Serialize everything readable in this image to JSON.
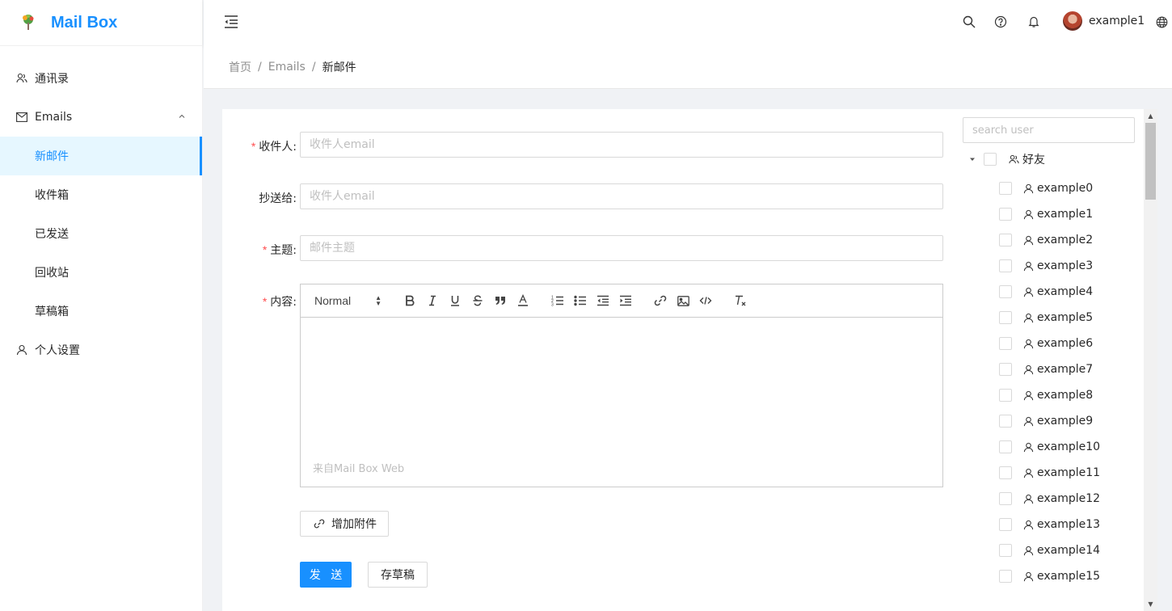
{
  "app": {
    "title": "Mail Box",
    "logo_icon": "tree-icon",
    "brand_color": "#1890ff"
  },
  "sidebar": {
    "items": [
      {
        "label": "通讯录",
        "icon": "contacts-icon"
      },
      {
        "label": "Emails",
        "icon": "mail-icon",
        "expanded": true
      },
      {
        "label": "新邮件",
        "active": true
      },
      {
        "label": "收件箱"
      },
      {
        "label": "已发送"
      },
      {
        "label": "回收站"
      },
      {
        "label": "草稿箱"
      },
      {
        "label": "个人设置",
        "icon": "user-icon"
      }
    ]
  },
  "header": {
    "username": "example1",
    "icons": [
      "menu-fold-icon",
      "search-icon",
      "help-icon",
      "bell-icon",
      "globe-icon"
    ]
  },
  "breadcrumb": {
    "home": "首页",
    "section": "Emails",
    "current": "新邮件",
    "separator": "/"
  },
  "form": {
    "recipient": {
      "label": "收件人:",
      "placeholder": "收件人email",
      "value": ""
    },
    "cc": {
      "label": "抄送给:",
      "placeholder": "收件人email",
      "value": ""
    },
    "subject": {
      "label": "主题:",
      "placeholder": "邮件主题",
      "value": ""
    },
    "content": {
      "label": "内容:",
      "signature": "来自Mail Box Web"
    },
    "required_mark": "*",
    "editor_toolbar": {
      "format_select": "Normal",
      "buttons": [
        "bold",
        "italic",
        "underline",
        "strike",
        "blockquote",
        "color",
        "ordered-list",
        "bullet-list",
        "outdent",
        "indent",
        "link",
        "image",
        "code",
        "clean"
      ]
    },
    "attach_label": "增加附件",
    "send_label": "发 送",
    "draft_label": "存草稿"
  },
  "user_tree": {
    "search_placeholder": "search user",
    "root_label": "好友",
    "users": [
      "example0",
      "example1",
      "example2",
      "example3",
      "example4",
      "example5",
      "example6",
      "example7",
      "example8",
      "example9",
      "example10",
      "example11",
      "example12",
      "example13",
      "example14",
      "example15"
    ]
  }
}
